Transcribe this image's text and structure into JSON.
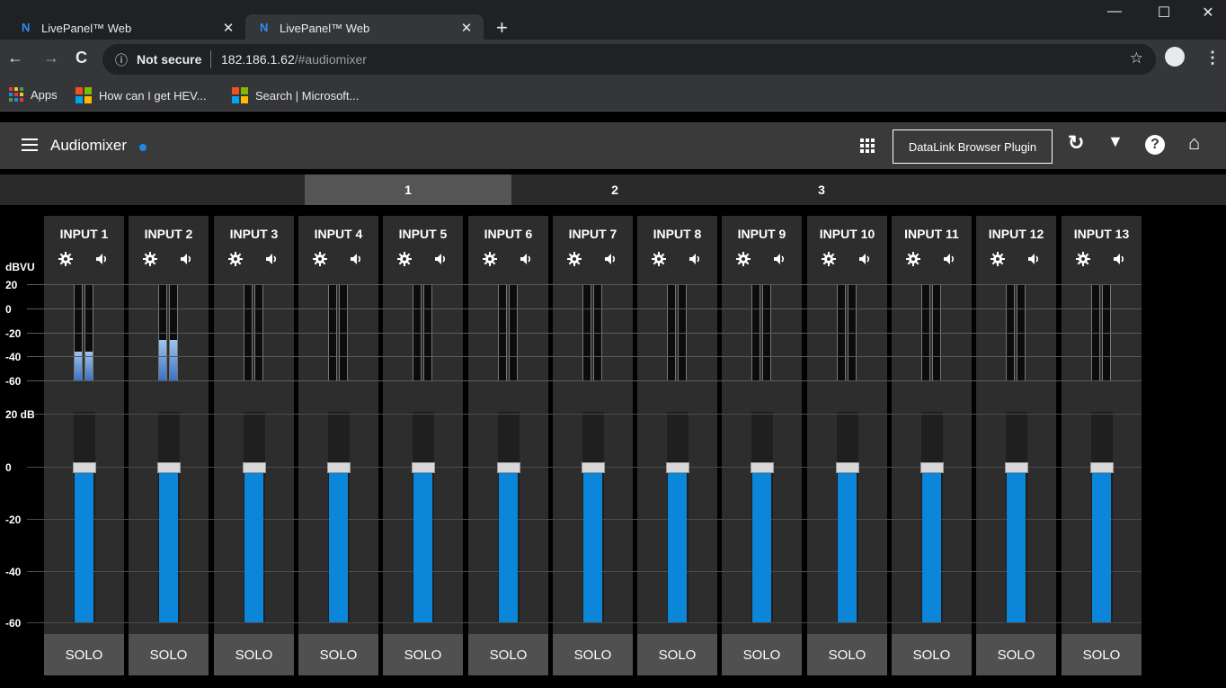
{
  "browser": {
    "tabs": [
      {
        "title": "LivePanel™ Web",
        "active": false
      },
      {
        "title": "LivePanel™ Web",
        "active": true
      }
    ],
    "new_tab": "+",
    "window_controls": {
      "minimize": "—",
      "maximize": "☐",
      "close": "✕"
    },
    "nav": {
      "back": "←",
      "forward": "→",
      "reload": "C"
    },
    "address": {
      "security": "Not secure",
      "host": "182.186.1.62",
      "path": "/#audiomixer"
    },
    "bookmarks": [
      {
        "label": "Apps",
        "icon": "apps-grid-icon"
      },
      {
        "label": "How can I get HEV...",
        "icon": "windows-logo-icon"
      },
      {
        "label": "Search | Microsoft...",
        "icon": "windows-logo-icon"
      }
    ]
  },
  "app": {
    "title": "Audiomixer",
    "status_color": "#1e88e5",
    "plugin_button": "DataLink Browser Plugin",
    "page_tabs": [
      {
        "label": "1",
        "active": true
      },
      {
        "label": "2",
        "active": false
      },
      {
        "label": "3",
        "active": false
      }
    ]
  },
  "scales": {
    "meter_unit": "dBVU",
    "meter_ticks": [
      "20",
      "0",
      "-20",
      "-40",
      "-60"
    ],
    "fader_ticks": [
      "20 dB",
      "0",
      "-20",
      "-40",
      "-60"
    ]
  },
  "channels": [
    {
      "name": "INPUT 1",
      "meter": [
        0.3,
        0.3
      ],
      "fader_db": 0,
      "solo": "SOLO"
    },
    {
      "name": "INPUT 2",
      "meter": [
        0.42,
        0.42
      ],
      "fader_db": 0,
      "solo": "SOLO"
    },
    {
      "name": "INPUT 3",
      "meter": [
        0,
        0
      ],
      "fader_db": 0,
      "solo": "SOLO"
    },
    {
      "name": "INPUT 4",
      "meter": [
        0,
        0
      ],
      "fader_db": 0,
      "solo": "SOLO"
    },
    {
      "name": "INPUT 5",
      "meter": [
        0,
        0
      ],
      "fader_db": 0,
      "solo": "SOLO"
    },
    {
      "name": "INPUT 6",
      "meter": [
        0,
        0
      ],
      "fader_db": 0,
      "solo": "SOLO"
    },
    {
      "name": "INPUT 7",
      "meter": [
        0,
        0
      ],
      "fader_db": 0,
      "solo": "SOLO"
    },
    {
      "name": "INPUT 8",
      "meter": [
        0,
        0
      ],
      "fader_db": 0,
      "solo": "SOLO"
    },
    {
      "name": "INPUT 9",
      "meter": [
        0,
        0
      ],
      "fader_db": 0,
      "solo": "SOLO"
    },
    {
      "name": "INPUT 10",
      "meter": [
        0,
        0
      ],
      "fader_db": 0,
      "solo": "SOLO"
    },
    {
      "name": "INPUT 11",
      "meter": [
        0,
        0
      ],
      "fader_db": 0,
      "solo": "SOLO"
    },
    {
      "name": "INPUT 12",
      "meter": [
        0,
        0
      ],
      "fader_db": 0,
      "solo": "SOLO"
    },
    {
      "name": "INPUT 13",
      "meter": [
        0,
        0
      ],
      "fader_db": 0,
      "solo": "SOLO"
    }
  ],
  "colors": {
    "fader_fill": "#0c86d9",
    "meter_fill": "#5d93d8"
  }
}
